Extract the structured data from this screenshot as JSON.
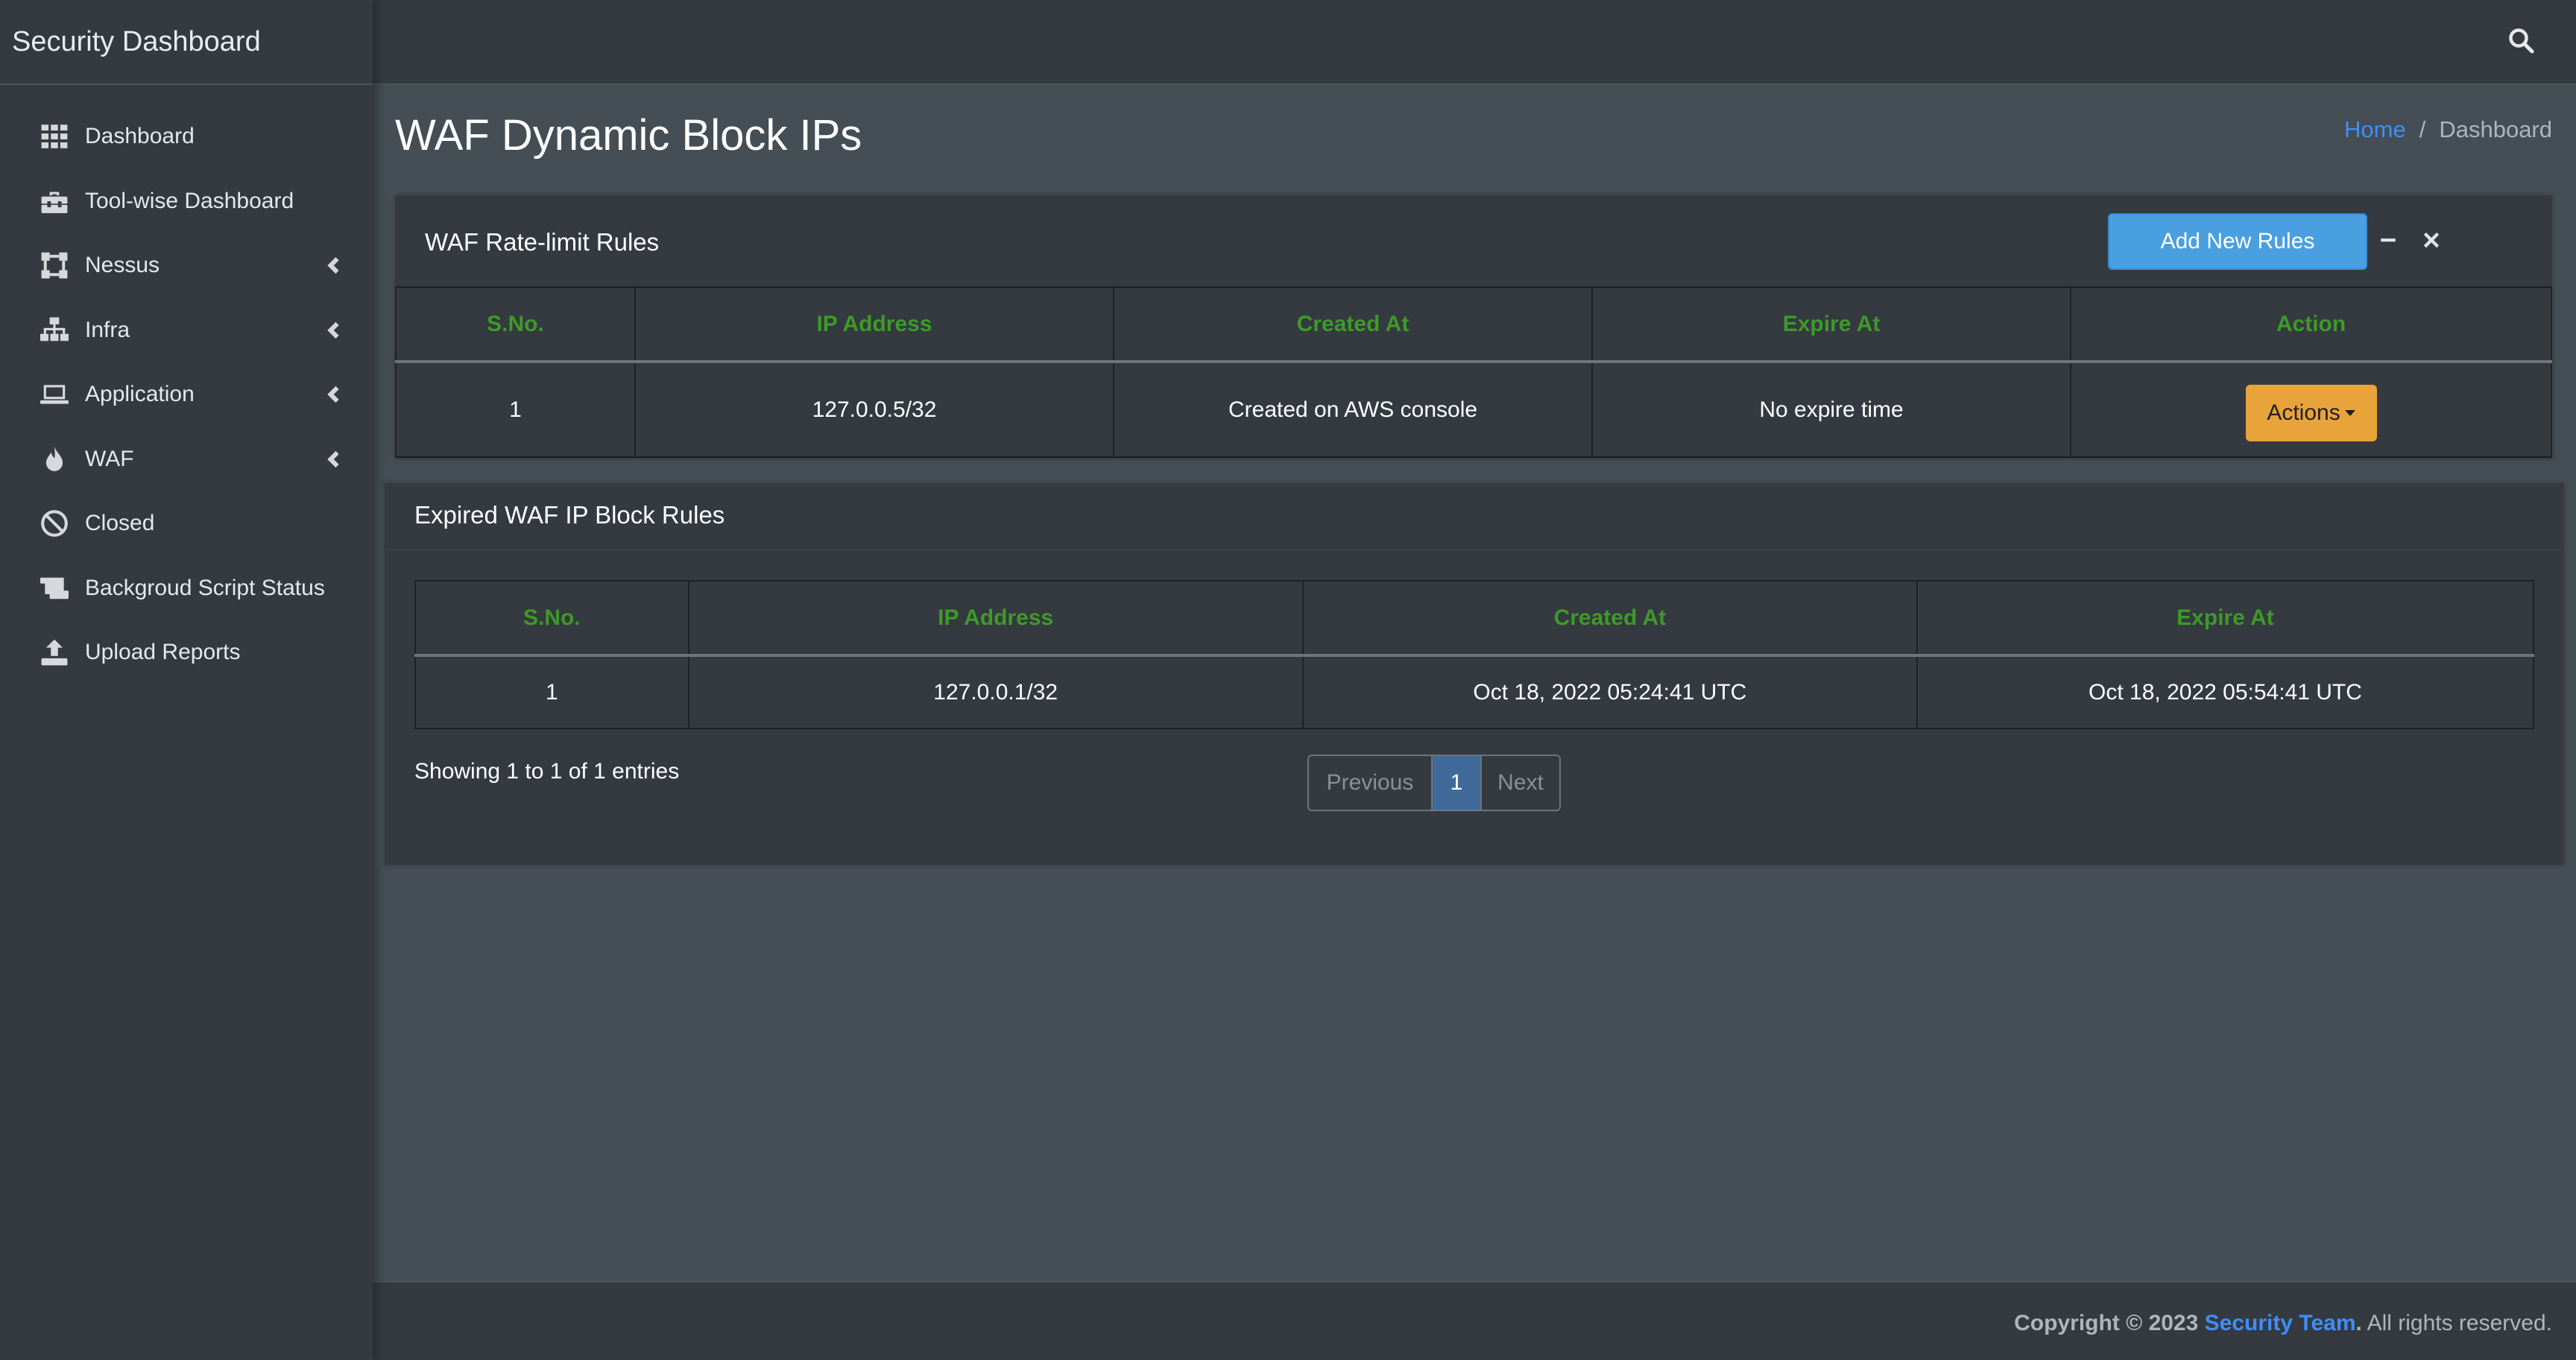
{
  "brand": "Security Dashboard",
  "sidebar": {
    "items": [
      {
        "label": "Dashboard",
        "icon": "grid-icon",
        "has_submenu": false
      },
      {
        "label": "Tool-wise Dashboard",
        "icon": "toolbox-icon",
        "has_submenu": false
      },
      {
        "label": "Nessus",
        "icon": "vector-square-icon",
        "has_submenu": true
      },
      {
        "label": "Infra",
        "icon": "network-icon",
        "has_submenu": true
      },
      {
        "label": "Application",
        "icon": "laptop-icon",
        "has_submenu": true
      },
      {
        "label": "WAF",
        "icon": "fire-icon",
        "has_submenu": true
      },
      {
        "label": "Closed",
        "icon": "ban-icon",
        "has_submenu": false
      },
      {
        "label": "Backgroud Script Status",
        "icon": "scroll-icon",
        "has_submenu": false
      },
      {
        "label": "Upload Reports",
        "icon": "upload-icon",
        "has_submenu": false
      }
    ]
  },
  "topbar": {
    "search_icon": "search-icon"
  },
  "page": {
    "title": "WAF Dynamic Block IPs",
    "breadcrumb": {
      "home": "Home",
      "separator": "/",
      "current": "Dashboard"
    }
  },
  "rate_limit_card": {
    "title": "WAF Rate-limit Rules",
    "add_button": "Add New Rules",
    "columns": [
      "S.No.",
      "IP Address",
      "Created At",
      "Expire At",
      "Action"
    ],
    "rows": [
      {
        "sno": "1",
        "ip": "127.0.0.5/32",
        "created": "Created on AWS console",
        "expire": "No expire time",
        "action": "Actions"
      }
    ]
  },
  "expired_card": {
    "title": "Expired WAF IP Block Rules",
    "columns": [
      "S.No.",
      "IP Address",
      "Created At",
      "Expire At"
    ],
    "rows": [
      {
        "sno": "1",
        "ip": "127.0.0.1/32",
        "created": "Oct 18, 2022 05:24:41 UTC",
        "expire": "Oct 18, 2022 05:54:41 UTC"
      }
    ],
    "entries_text": "Showing 1 to 1 of 1 entries",
    "pagination": {
      "previous": "Previous",
      "current": "1",
      "next": "Next"
    }
  },
  "footer": {
    "copyright": "Copyright © 2023",
    "team": "Security Team",
    "period": ".",
    "rights": "All rights reserved."
  },
  "colors": {
    "sidebar_bg": "#343a40",
    "content_bg": "#454d55",
    "header_green": "#3e9a28",
    "primary_button": "#4a9fe0",
    "warning_button": "#e8a33b",
    "link_blue": "#3f8ef7"
  }
}
